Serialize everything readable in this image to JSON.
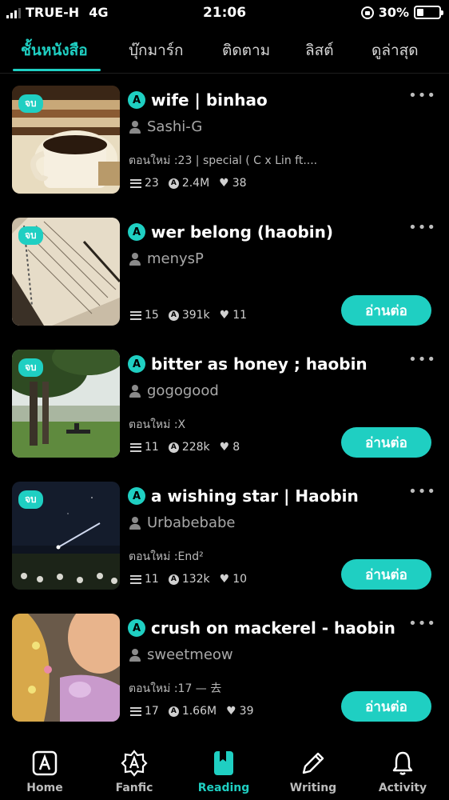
{
  "status_bar": {
    "carrier": "TRUE-H",
    "network": "4G",
    "time": "21:06",
    "battery": "30%",
    "battery_level": 0.3
  },
  "tabs": [
    {
      "label": "ชั้นหนังสือ",
      "active": true
    },
    {
      "label": "บุ๊กมาร์ก",
      "active": false
    },
    {
      "label": "ติดตาม",
      "active": false
    },
    {
      "label": "ลิสต์",
      "active": false
    },
    {
      "label": "ดูล่าสุด",
      "active": false
    }
  ],
  "stories": [
    {
      "badge": "จบ",
      "title": "wife | binhao",
      "author": "Sashi-G",
      "update": "ตอนใหม่ :23 | special ( C x Lin ft....",
      "chapters": "23",
      "reads": "2.4M",
      "likes": "38",
      "continue_label": ""
    },
    {
      "badge": "จบ",
      "title": "wer belong (haobin)",
      "author": "menysP",
      "update": "",
      "chapters": "15",
      "reads": "391k",
      "likes": "11",
      "continue_label": "อ่านต่อ"
    },
    {
      "badge": "จบ",
      "title": "bitter as honey ; haobin",
      "author": "gogogood",
      "update": "ตอนใหม่ :X",
      "chapters": "11",
      "reads": "228k",
      "likes": "8",
      "continue_label": "อ่านต่อ"
    },
    {
      "badge": "จบ",
      "title": "a wishing star | Haobin",
      "author": "Urbabebabe",
      "update": "ตอนใหม่ :End²",
      "chapters": "11",
      "reads": "132k",
      "likes": "10",
      "continue_label": "อ่านต่อ"
    },
    {
      "badge": "",
      "title": "crush on mackerel - haobin",
      "author": "sweetmeow",
      "update": "ตอนใหม่ :17 — 去",
      "chapters": "17",
      "reads": "1.66M",
      "likes": "39",
      "continue_label": "อ่านต่อ"
    }
  ],
  "bottom_nav": [
    {
      "label": "Home",
      "icon": "a-square-icon",
      "active": false
    },
    {
      "label": "Fanfic",
      "icon": "a-badge-icon",
      "active": false
    },
    {
      "label": "Reading",
      "icon": "bookmark-book-icon",
      "active": true
    },
    {
      "label": "Writing",
      "icon": "pencil-icon",
      "active": false
    },
    {
      "label": "Activity",
      "icon": "bell-icon",
      "active": false
    }
  ],
  "colors": {
    "accent": "#1fcfc2",
    "background": "#000000"
  },
  "icon_glyphs": {
    "app_letter": "A"
  }
}
